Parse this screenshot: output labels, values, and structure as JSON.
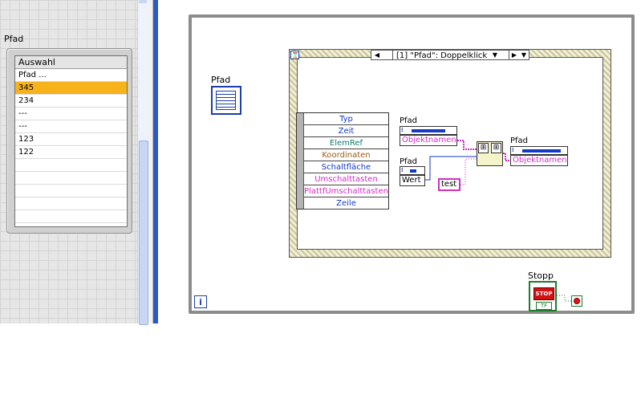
{
  "front_panel": {
    "label": "Pfad",
    "listbox": {
      "header": "Auswahl",
      "rows": [
        "Pfad ...",
        "345",
        "234",
        "---",
        "---",
        "123",
        "122",
        "",
        "",
        "",
        "",
        ""
      ],
      "selected_index": 1
    }
  },
  "block_diagram": {
    "listbox_terminal_label": "Pfad",
    "iteration_label": "i",
    "event_selector": {
      "left_arrow": "◀",
      "case_label": "[1] \"Pfad\": Doppelklick",
      "down_arrow": "▼",
      "right_arrow": "▶"
    },
    "event_data": [
      "Typ",
      "Zeit",
      "ElemRef",
      "Koordinaten",
      "Schaltfläche",
      "Umschalttasten",
      "PlattfUmschalttasten",
      "Zeile"
    ],
    "property_node_1": {
      "title": "Pfad",
      "property": "Objektnamen"
    },
    "property_node_2": {
      "title": "Pfad",
      "property": "Wert"
    },
    "property_node_3": {
      "title": "Pfad",
      "property": "Objektnamen"
    },
    "string_constant": "test",
    "stop_label": "Stopp",
    "stop_button_text": "STOP",
    "stop_tf": "TF"
  },
  "colors": {
    "selection": "#f6b31c",
    "blue_wire": "#1439c9",
    "pink_wire": "#d12fc8",
    "stop_red": "#d11212"
  }
}
